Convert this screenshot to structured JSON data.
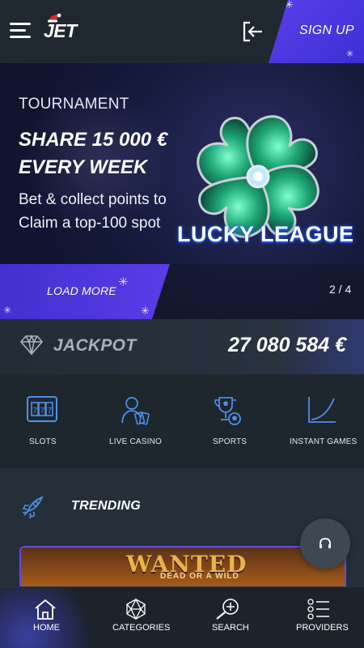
{
  "header": {
    "logo": "JET",
    "signup_label": "SIGN UP"
  },
  "banner": {
    "kicker": "TOURNAMENT",
    "title_line1": "SHARE 15 000 €",
    "title_line2": "EVERY WEEK",
    "text_line1": "Bet & collect points to",
    "text_line2": "Claim a top-100 spot",
    "brand": "LUCKY LEAGUE",
    "load_more_label": "LOAD MORE",
    "pager": "2 / 4"
  },
  "jackpot": {
    "label": "JACKPOT",
    "amount": "27 080 584 €"
  },
  "categories": [
    {
      "label": "SLOTS",
      "icon": "slot-machine-icon"
    },
    {
      "label": "LIVE CASINO",
      "icon": "dealer-icon"
    },
    {
      "label": "SPORTS",
      "icon": "trophy-ball-icon"
    },
    {
      "label": "INSTANT GAMES",
      "icon": "curve-chart-icon"
    }
  ],
  "trending": {
    "label": "TRENDING",
    "game_title": "WANTED",
    "game_subtitle": "DEAD OR A WILD"
  },
  "bottom_nav": [
    {
      "label": "HOME",
      "icon": "home-icon"
    },
    {
      "label": "CATEGORIES",
      "icon": "dice-icon"
    },
    {
      "label": "SEARCH",
      "icon": "search-icon"
    },
    {
      "label": "PROVIDERS",
      "icon": "list-icon"
    }
  ],
  "colors": {
    "accent": "#4a34dc",
    "background": "#1e262e",
    "category_icon": "#4f8fe6"
  }
}
